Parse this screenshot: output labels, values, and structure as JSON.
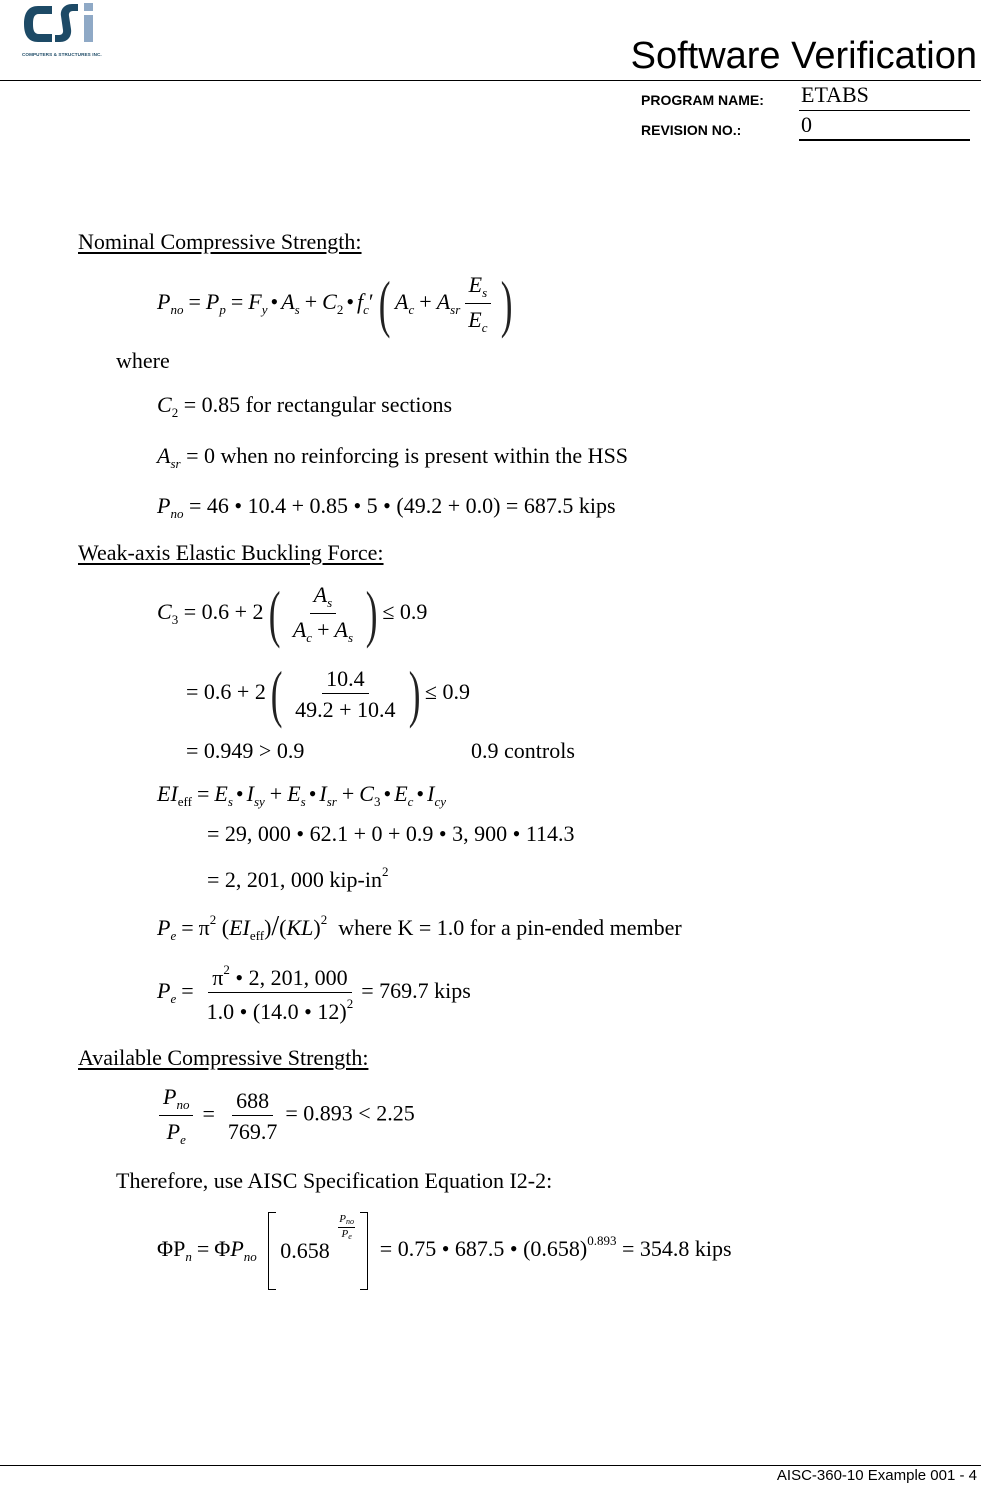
{
  "header": {
    "logo_text": "CSi",
    "logo_tagline": "COMPUTERS & STRUCTURES INC.",
    "logo_colors": {
      "primary": "#1d4a66",
      "accent": "#8fa9c6"
    },
    "title": "Software Verification",
    "program_name_label": "PROGRAM NAME:",
    "program_name_value": "ETABS",
    "revision_label": "REVISION NO.:",
    "revision_value": "0"
  },
  "sections": {
    "nominal": {
      "heading": "Nominal Compressive Strength:",
      "where": "where",
      "c2_value": "= 0.85 for rectangular sections",
      "asr_value": "= 0 when no reinforcing is present within the HSS",
      "pno_calc": "= 46 • 10.4 + 0.85 • 5 • (49.2 + 0.0) = 687.5 kips"
    },
    "buckling": {
      "heading": "Weak-axis Elastic Buckling Force:",
      "c3_line1_prefix": "= 0.6 + 2",
      "c3_line1_suffix": "≤ 0.9",
      "c3_line2_prefix": "= 0.6 + 2",
      "c3_line2_num": "10.4",
      "c3_line2_den": "49.2 + 10.4",
      "c3_line2_suffix": "≤ 0.9",
      "c3_line3": "= 0.949 > 0.9",
      "c3_controls": "0.9 controls",
      "ei_line2": "= 29, 000 • 62.1 + 0 + 0.9 • 3, 900 • 114.3",
      "ei_line3": "= 2, 201, 000 kip-in",
      "pe_formula_tail": "where K = 1.0 for a pin-ended member",
      "pe_num": "• 2, 201, 000",
      "pe_den": "1.0 • (14.0 • 12)",
      "pe_result": "= 769.7 kips"
    },
    "available": {
      "heading": "Available Compressive Strength:",
      "ratio_num": "688",
      "ratio_den": "769.7",
      "ratio_result": "= 0.893 < 2.25",
      "therefore": "Therefore, use AISC Specification Equation I2-2:",
      "phi_base": "0.658",
      "phi_result": "= 0.75 • 687.5 • (0.658)",
      "phi_exp": "0.893",
      "phi_final": "= 354.8 kips"
    }
  },
  "footer": {
    "page_label": "AISC-360-10 Example 001 - 4"
  }
}
